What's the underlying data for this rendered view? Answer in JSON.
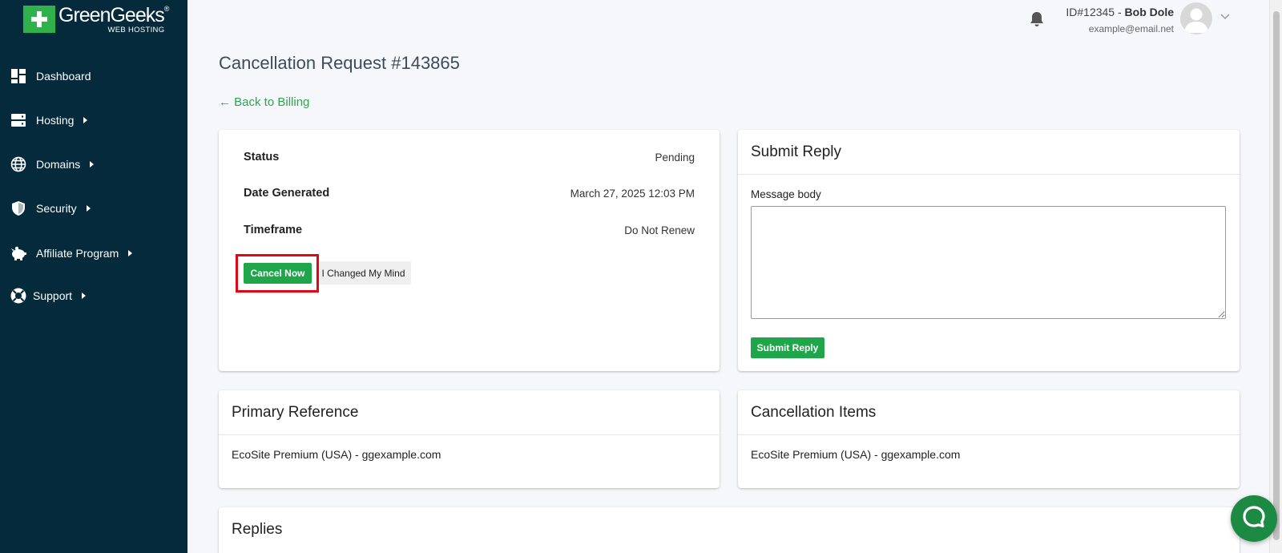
{
  "brand": {
    "name": "GreenGeeks",
    "reg": "®",
    "subtitle": "WEB HOSTING"
  },
  "sidebar": {
    "items": [
      {
        "label": "Dashboard",
        "icon": "dashboard-icon"
      },
      {
        "label": "Hosting",
        "icon": "server-icon"
      },
      {
        "label": "Domains",
        "icon": "globe-icon"
      },
      {
        "label": "Security",
        "icon": "shield-icon"
      },
      {
        "label": "Affiliate Program",
        "icon": "piggy-bank-icon"
      },
      {
        "label": "Support",
        "icon": "lifebuoy-icon"
      }
    ]
  },
  "header": {
    "user_id": "ID#12345 - ",
    "user_name": "Bob Dole",
    "email": "example@email.net"
  },
  "page": {
    "title": "Cancellation Request #143865",
    "back_link": "← Back to Billing"
  },
  "details": {
    "status_label": "Status",
    "status_value": "Pending",
    "date_label": "Date Generated",
    "date_value": "March 27, 2025 12:03 PM",
    "timeframe_label": "Timeframe",
    "timeframe_value": "Do Not Renew",
    "cancel_now": "Cancel Now",
    "changed_mind": "I Changed My Mind"
  },
  "reply": {
    "title": "Submit Reply",
    "message_label": "Message body",
    "message_value": "",
    "submit": "Submit Reply"
  },
  "primary_reference": {
    "title": "Primary Reference",
    "text": "EcoSite Premium (USA) - ggexample.com"
  },
  "cancellation_items": {
    "title": "Cancellation Items",
    "text": "EcoSite Premium (USA) - ggexample.com"
  },
  "replies": {
    "title": "Replies"
  },
  "colors": {
    "sidebar": "#042a3b",
    "brand_green": "#2fb14b",
    "button_green": "#1fa64b",
    "highlight": "#e30613"
  }
}
